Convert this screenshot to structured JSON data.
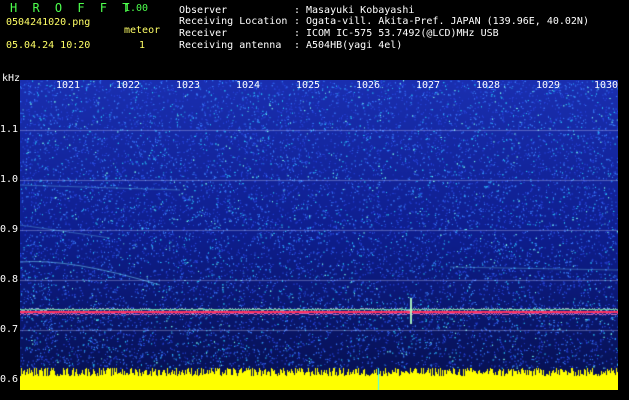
{
  "header": {
    "app_title": "H R O F F T",
    "version": "1.00",
    "filename": "0504241020.png",
    "meteor_label": "meteor",
    "datetime": "05.04.24 10:20",
    "meteor_count": "1"
  },
  "info": [
    {
      "label": "Observer",
      "value": "Masayuki Kobayashi"
    },
    {
      "label": "Receiving Location",
      "value": "Ogata-vill. Akita-Pref. JAPAN (139.96E, 40.02N)"
    },
    {
      "label": "Receiver",
      "value": "ICOM IC-575 53.7492(@LCD)MHz USB"
    },
    {
      "label": "Receiving antenna",
      "value": "A504HB(yagi 4el)"
    }
  ],
  "axis": {
    "unit": "kHz",
    "y_ticks": [
      "1.1",
      "1.0",
      "0.9",
      "0.8",
      "0.7",
      "0.6"
    ],
    "x_ticks": [
      "1021",
      "1022",
      "1023",
      "1024",
      "1025",
      "1026",
      "1027",
      "1028",
      "1029",
      "1030"
    ]
  },
  "colors": {
    "background": "#000000",
    "spectrogram_base": "#0a1a8a",
    "signal": "#ff3060",
    "level_bars": "#ffff00",
    "title_green": "#4dff4d",
    "accent_yellow": "#ffff66"
  }
}
